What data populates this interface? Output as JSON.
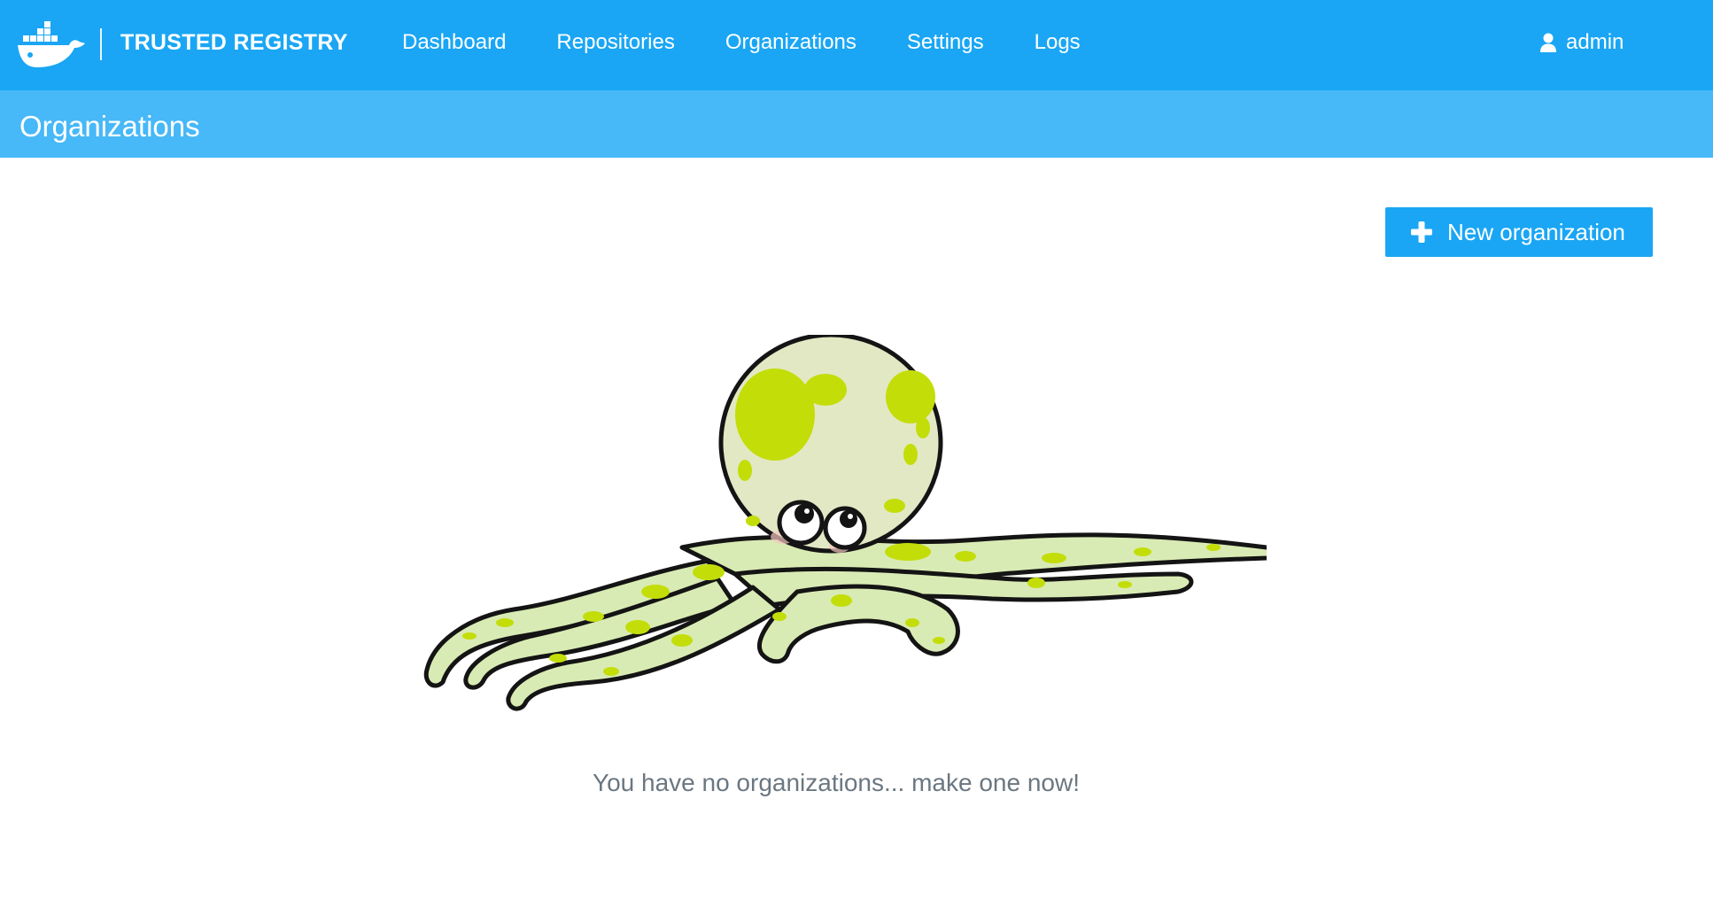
{
  "header": {
    "brand": "TRUSTED REGISTRY",
    "logo_icon": "docker-whale-icon",
    "nav": [
      {
        "label": "Dashboard"
      },
      {
        "label": "Repositories"
      },
      {
        "label": "Organizations"
      },
      {
        "label": "Settings"
      },
      {
        "label": "Logs"
      }
    ],
    "user": {
      "name": "admin",
      "icon": "user-icon"
    }
  },
  "subheader": {
    "title": "Organizations"
  },
  "actions": {
    "new_org_label": "New organization",
    "new_org_icon": "plus-icon"
  },
  "empty_state": {
    "message": "You have no organizations... make one now!",
    "illustration": "octopus-illustration"
  },
  "colors": {
    "topbar": "#1aa6f4",
    "subbar": "#47b8f8",
    "button": "#1aa6f4",
    "empty_text": "#6b7781"
  }
}
